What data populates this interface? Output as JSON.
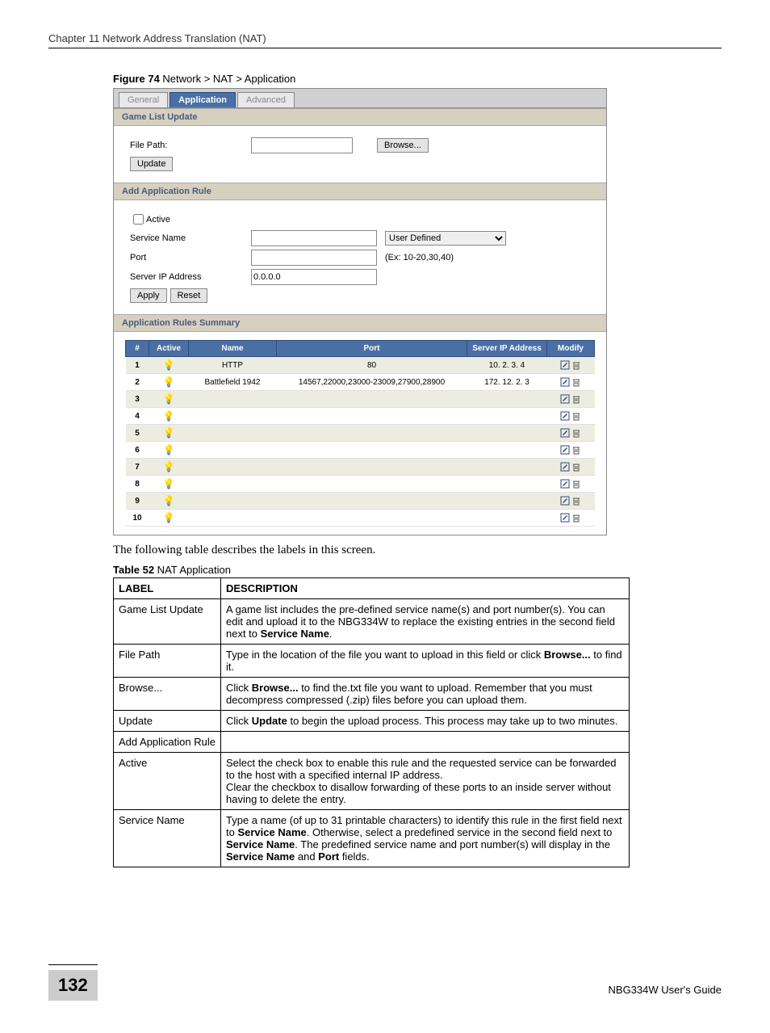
{
  "chapter_header": "Chapter 11 Network Address Translation (NAT)",
  "figure_caption_bold": "Figure 74",
  "figure_caption_rest": "   Network > NAT > Application",
  "tabs": {
    "general": "General",
    "application": "Application",
    "advanced": "Advanced"
  },
  "sections": {
    "game_list": "Game List Update",
    "add_rule": "Add Application Rule",
    "summary": "Application Rules Summary"
  },
  "labels": {
    "file_path": "File Path:",
    "update": "Update",
    "browse": "Browse...",
    "active": "Active",
    "service_name": "Service Name",
    "port": "Port",
    "server_ip": "Server IP Address",
    "apply": "Apply",
    "reset": "Reset",
    "user_defined": "User Defined",
    "port_hint": "(Ex: 10-20,30,40)",
    "ip_default": "0.0.0.0"
  },
  "headers": {
    "num": "#",
    "active": "Active",
    "name": "Name",
    "port": "Port",
    "server_ip": "Server IP Address",
    "modify": "Modify"
  },
  "rows": [
    {
      "n": "1",
      "active": true,
      "name": "HTTP",
      "port": "80",
      "ip": "10. 2. 3. 4"
    },
    {
      "n": "2",
      "active": true,
      "name": "Battlefield 1942",
      "port": "14567,22000,23000-23009,27900,28900",
      "ip": "172. 12. 2. 3"
    },
    {
      "n": "3",
      "active": false,
      "name": "",
      "port": "",
      "ip": ""
    },
    {
      "n": "4",
      "active": false,
      "name": "",
      "port": "",
      "ip": ""
    },
    {
      "n": "5",
      "active": false,
      "name": "",
      "port": "",
      "ip": ""
    },
    {
      "n": "6",
      "active": false,
      "name": "",
      "port": "",
      "ip": ""
    },
    {
      "n": "7",
      "active": false,
      "name": "",
      "port": "",
      "ip": ""
    },
    {
      "n": "8",
      "active": false,
      "name": "",
      "port": "",
      "ip": ""
    },
    {
      "n": "9",
      "active": false,
      "name": "",
      "port": "",
      "ip": ""
    },
    {
      "n": "10",
      "active": false,
      "name": "",
      "port": "",
      "ip": ""
    }
  ],
  "narrative": "The following table describes the labels in this screen.",
  "table_caption_bold": "Table 52",
  "table_caption_rest": "   NAT Application",
  "desc_headers": {
    "label": "LABEL",
    "desc": "DESCRIPTION"
  },
  "desc_rows": [
    {
      "label": "Game List Update",
      "desc": "A game list includes the pre-defined service name(s) and port number(s). You can edit and upload it to the NBG334W to replace the existing entries in the second field next to <b>Service Name</b>."
    },
    {
      "label": "File Path",
      "desc": "Type in the location of the file you want to upload in this field or click <b>Browse...</b> to find it."
    },
    {
      "label": "Browse...",
      "desc": "Click <b>Browse...</b> to find the.txt file you want to upload. Remember that you must decompress compressed (.zip) files before you can upload them."
    },
    {
      "label": "Update",
      "desc": "Click <b>Update</b> to begin the upload process. This process may take up to two minutes."
    },
    {
      "label": "Add Application Rule",
      "desc": ""
    },
    {
      "label": "Active",
      "desc": "Select the check box to enable this rule and the requested service can be forwarded to the host with a specified internal IP address.<br>Clear the checkbox to disallow forwarding of these ports to an inside server without having to delete the entry."
    },
    {
      "label": "Service Name",
      "desc": "Type a name (of up to 31 printable characters) to identify this rule in the first field next to <b>Service Name</b>. Otherwise, select a predefined service in the second field next to <b>Service Name</b>. The predefined service name and port number(s) will display in the <b>Service Name</b> and <b>Port</b> fields."
    }
  ],
  "footer": {
    "page": "132",
    "guide": "NBG334W User's Guide"
  }
}
